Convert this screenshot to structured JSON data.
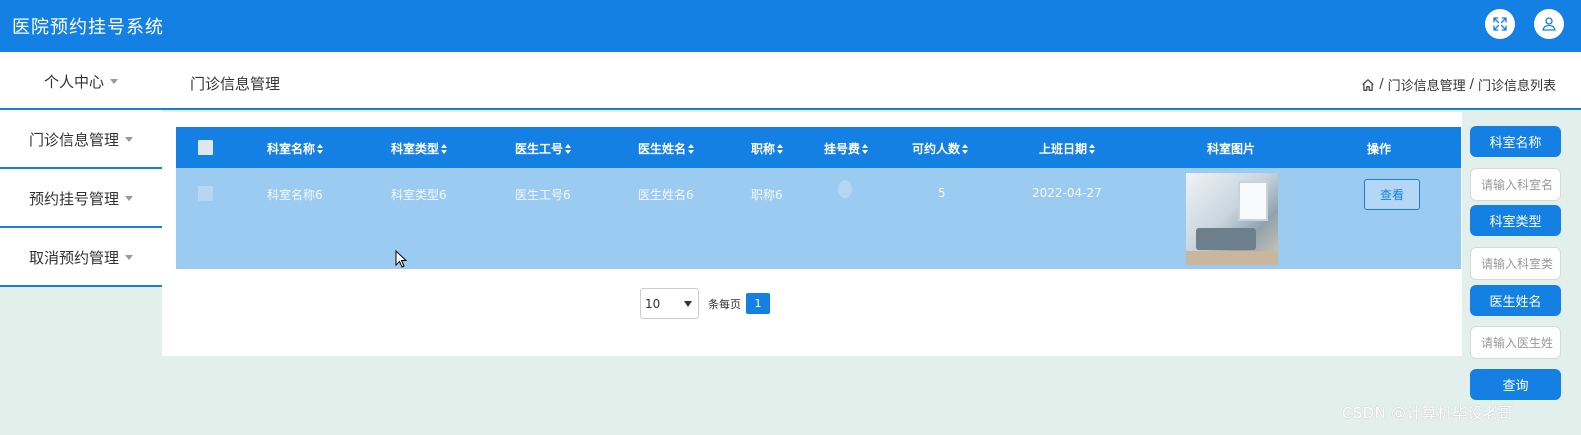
{
  "app": {
    "title": "医院预约挂号系统"
  },
  "topbar_icons": {
    "expand": "expand-arrows-icon",
    "user": "user-icon"
  },
  "sidebar": {
    "items": [
      {
        "label": "个人中心"
      },
      {
        "label": "门诊信息管理"
      },
      {
        "label": "预约挂号管理"
      },
      {
        "label": "取消预约管理"
      }
    ]
  },
  "header": {
    "title": "门诊信息管理",
    "breadcrumb": [
      "门诊信息管理",
      "门诊信息列表"
    ],
    "sep": "/"
  },
  "table": {
    "columns": [
      "科室名称",
      "科室类型",
      "医生工号",
      "医生姓名",
      "职称",
      "挂号费",
      "可约人数",
      "上班日期",
      "科室图片",
      "操作"
    ],
    "rows": [
      {
        "dept_name": "科室名称6",
        "dept_type": "科室类型6",
        "doctor_id": "医生工号6",
        "doctor_name": "医生姓名6",
        "title": "职称6",
        "fee": "",
        "available": "5",
        "work_date": "2022-04-27",
        "action": "查看"
      }
    ]
  },
  "pagination": {
    "page_size": "10",
    "per_page_label": "条每页",
    "current_page": "1"
  },
  "search": {
    "dept_name_label": "科室名称",
    "dept_name_placeholder": "请输入科室名",
    "dept_type_label": "科室类型",
    "dept_type_placeholder": "请输入科室类",
    "doctor_name_label": "医生姓名",
    "doctor_name_placeholder": "请输入医生姓",
    "query_label": "查询"
  },
  "watermark": "CSDN @计算机毕设老哥",
  "colors": {
    "primary": "#1480e3",
    "row_highlight": "#9ccbf1",
    "background": "#e2efea"
  }
}
